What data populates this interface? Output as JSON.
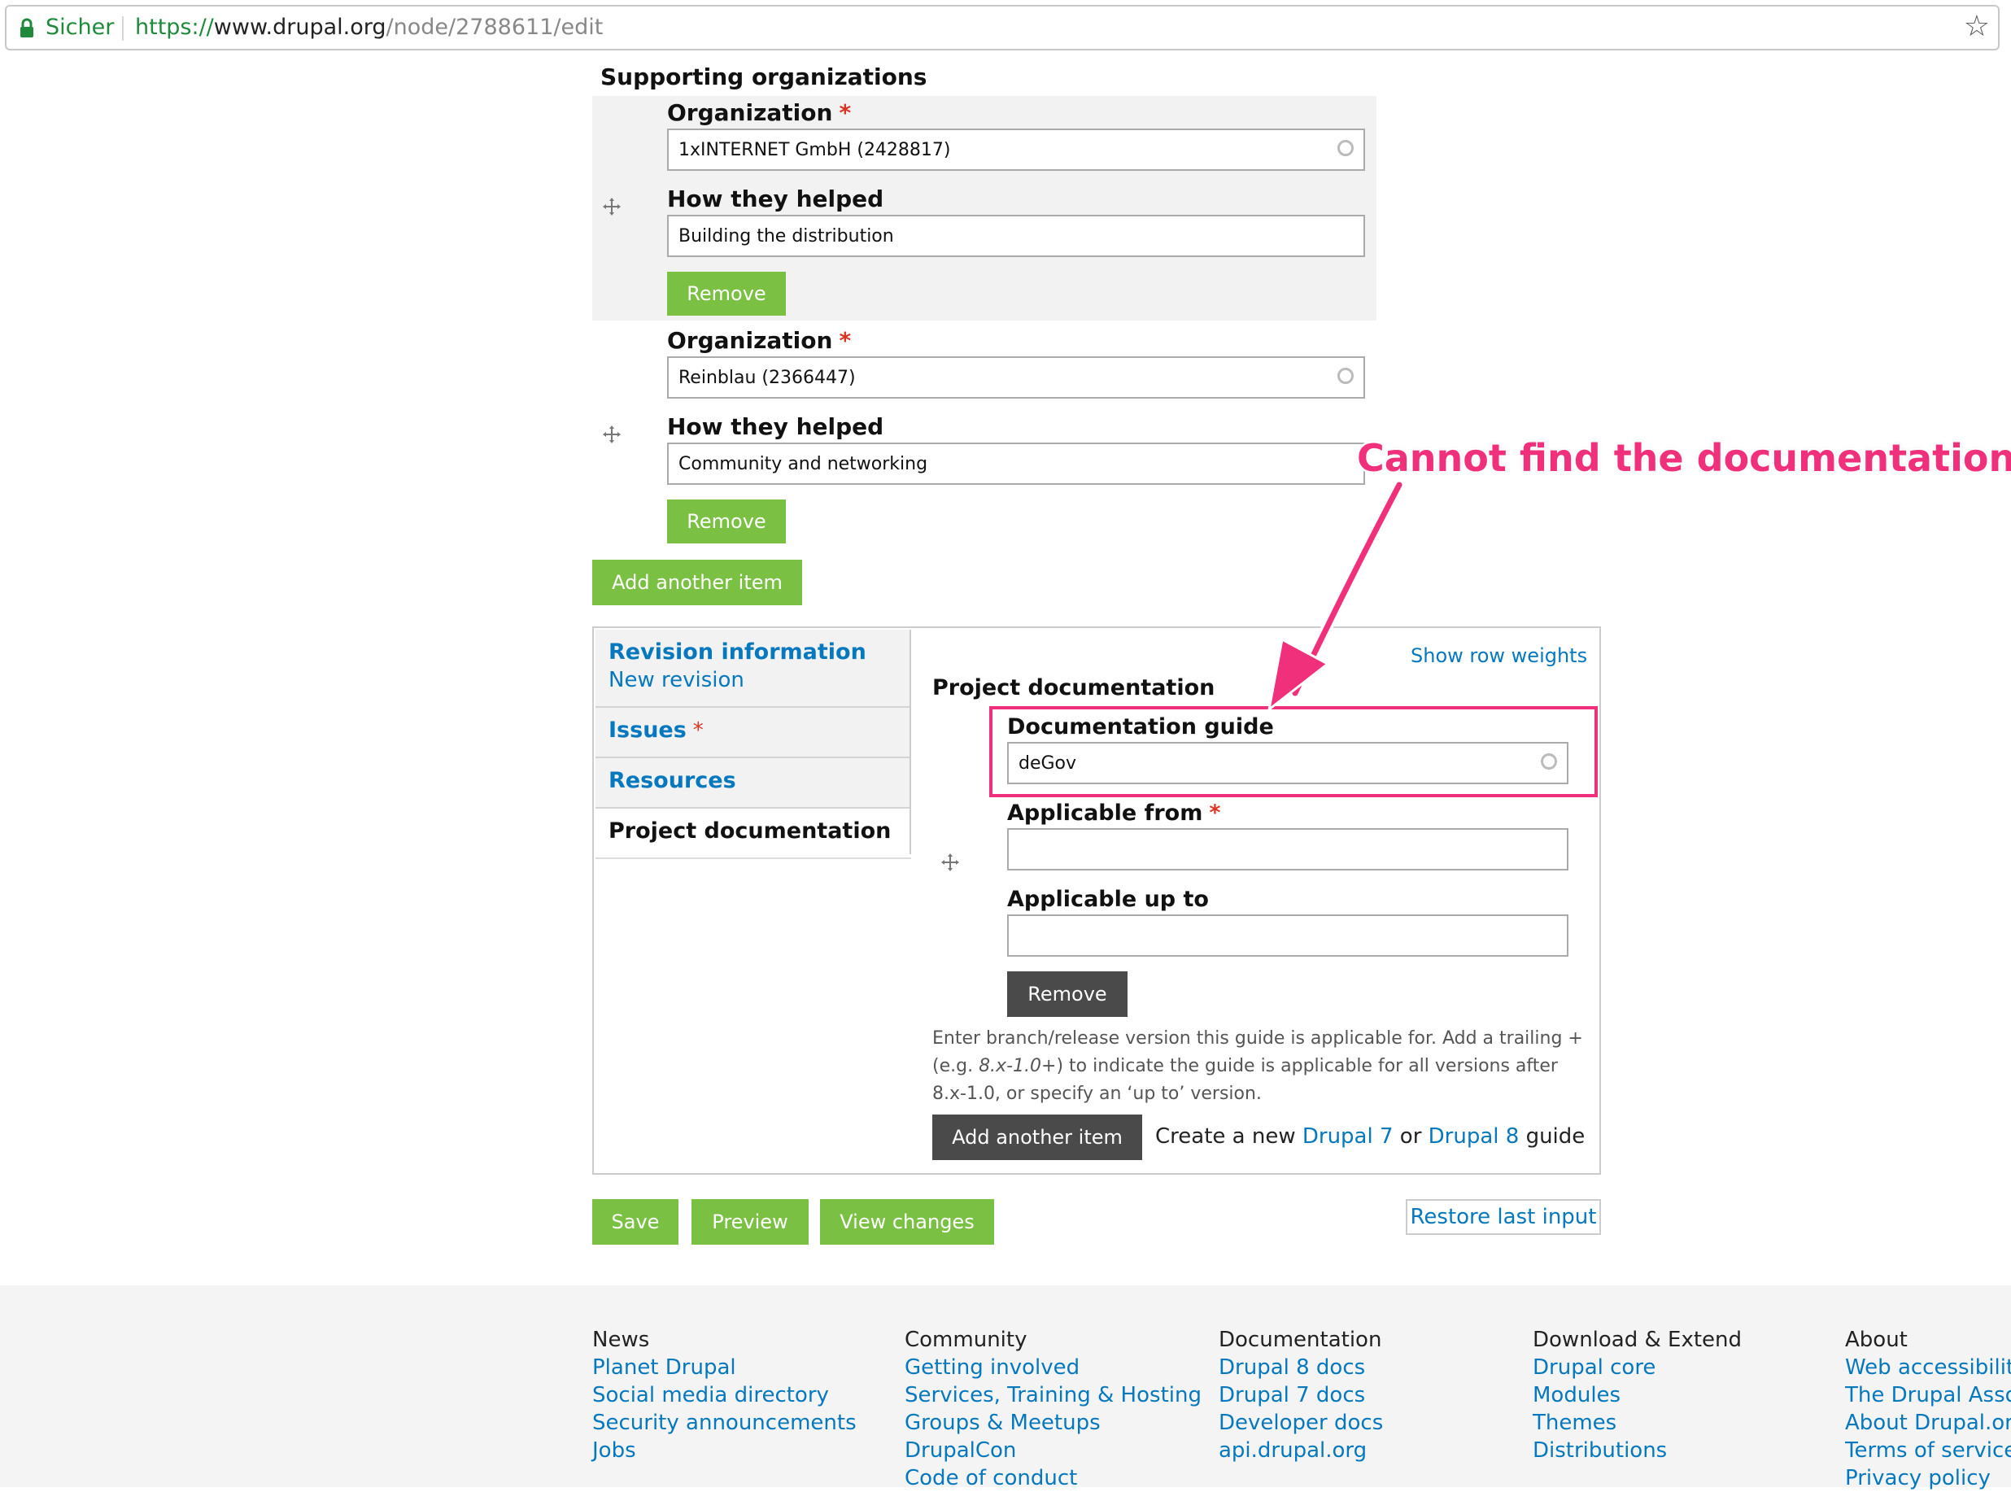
{
  "browser": {
    "secure_label": "Sicher",
    "url_scheme": "https://",
    "url_host": "www.drupal.org",
    "url_path": "/node/2788611/edit"
  },
  "supporting": {
    "heading": "Supporting organizations",
    "items": [
      {
        "org_label": "Organization",
        "org_value": "1xINTERNET GmbH (2428817)",
        "help_label": "How they helped",
        "help_value": "Building the distribution",
        "remove_label": "Remove"
      },
      {
        "org_label": "Organization",
        "org_value": "Reinblau (2366447)",
        "help_label": "How they helped",
        "help_value": "Community and networking",
        "remove_label": "Remove"
      }
    ],
    "add_label": "Add another item"
  },
  "tabs": {
    "items": [
      {
        "title": "Revision information",
        "summary": "New revision"
      },
      {
        "title": "Issues",
        "summary": ""
      },
      {
        "title": "Resources",
        "summary": ""
      },
      {
        "title": "Project documentation",
        "summary": ""
      }
    ],
    "required_mark": "*"
  },
  "project_doc": {
    "show_weights": "Show row weights",
    "heading": "Project documentation",
    "guide_label": "Documentation guide",
    "guide_value": "deGov",
    "from_label": "Applicable from",
    "from_value": "",
    "upto_label": "Applicable up to",
    "upto_value": "",
    "remove_label": "Remove",
    "help_line1": "Enter branch/release version this guide is applicable for. Add a trailing +",
    "help_line2_pre": "(e.g. ",
    "help_line2_em": "8.x-1.0+",
    "help_line2_post": ") to indicate the guide is applicable for all versions after",
    "help_line3": "8.x-1.0, or specify an ‘up to’ version.",
    "add_label": "Add another item",
    "create_pre": "Create a new",
    "create_d7": "Drupal 7",
    "create_or": "or",
    "create_d8": "Drupal 8",
    "create_post": "guide"
  },
  "actions": {
    "save": "Save",
    "preview": "Preview",
    "view_changes": "View changes",
    "restore": "Restore last input"
  },
  "annotation": {
    "text": "Cannot find the documentation.",
    "color": "#f0307a"
  },
  "footer": {
    "columns": [
      {
        "heading": "News",
        "links": [
          "Planet Drupal",
          "Social media directory",
          "Security announcements",
          "Jobs"
        ]
      },
      {
        "heading": "Community",
        "links": [
          "Getting involved",
          "Services, Training & Hosting",
          "Groups & Meetups",
          "DrupalCon",
          "Code of conduct"
        ]
      },
      {
        "heading": "Documentation",
        "links": [
          "Drupal 8 docs",
          "Drupal 7 docs",
          "Developer docs",
          "api.drupal.org"
        ]
      },
      {
        "heading": "Download & Extend",
        "links": [
          "Drupal core",
          "Modules",
          "Themes",
          "Distributions"
        ]
      },
      {
        "heading": "About",
        "links": [
          "Web accessibility",
          "The Drupal Assoc",
          "About Drupal.org",
          "Terms of service",
          "Privacy policy"
        ]
      }
    ]
  },
  "colors": {
    "brand_green": "#7ac143",
    "link_blue": "#0678be",
    "dark_button": "#4a4a4a",
    "highlight": "#f0307a"
  }
}
